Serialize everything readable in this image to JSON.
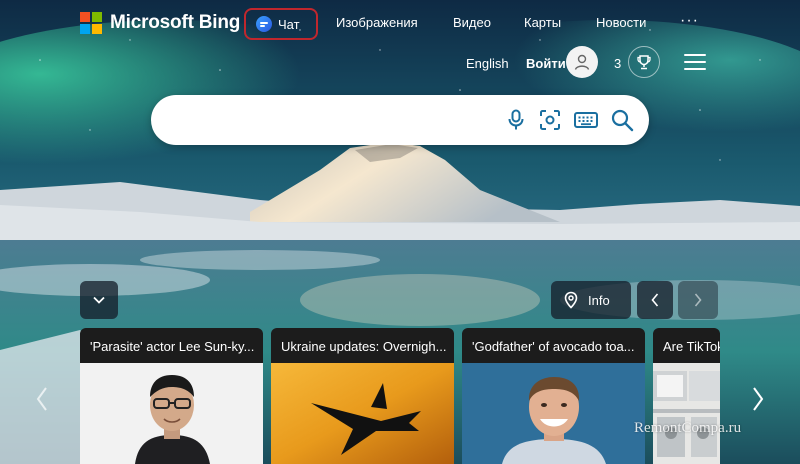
{
  "brand": {
    "name": "Microsoft Bing",
    "logo_colors": [
      "#f25022",
      "#7fba00",
      "#00a4ef",
      "#ffb900"
    ]
  },
  "nav": {
    "chat_label": "Чат",
    "items": [
      {
        "label": "Изображения"
      },
      {
        "label": "Видео"
      },
      {
        "label": "Карты"
      },
      {
        "label": "Новости"
      }
    ],
    "more_label": "···"
  },
  "header_right": {
    "language": "English",
    "signin_label": "Войти",
    "rewards_count": "3"
  },
  "search": {
    "value": "",
    "placeholder": "",
    "icons": [
      "microphone-icon",
      "visual-search-icon",
      "keyboard-icon",
      "search-icon"
    ],
    "accent_color": "#1a6fa0"
  },
  "controls": {
    "info_label": "Info"
  },
  "cards": [
    {
      "title": "'Parasite' actor Lee Sun-ky..."
    },
    {
      "title": "Ukraine updates: Overnigh..."
    },
    {
      "title": "'Godfather' of avocado toa..."
    },
    {
      "title": "Are TikTok"
    }
  ],
  "highlight_color": "#c0272d",
  "watermark": "RemontCompa.ru"
}
